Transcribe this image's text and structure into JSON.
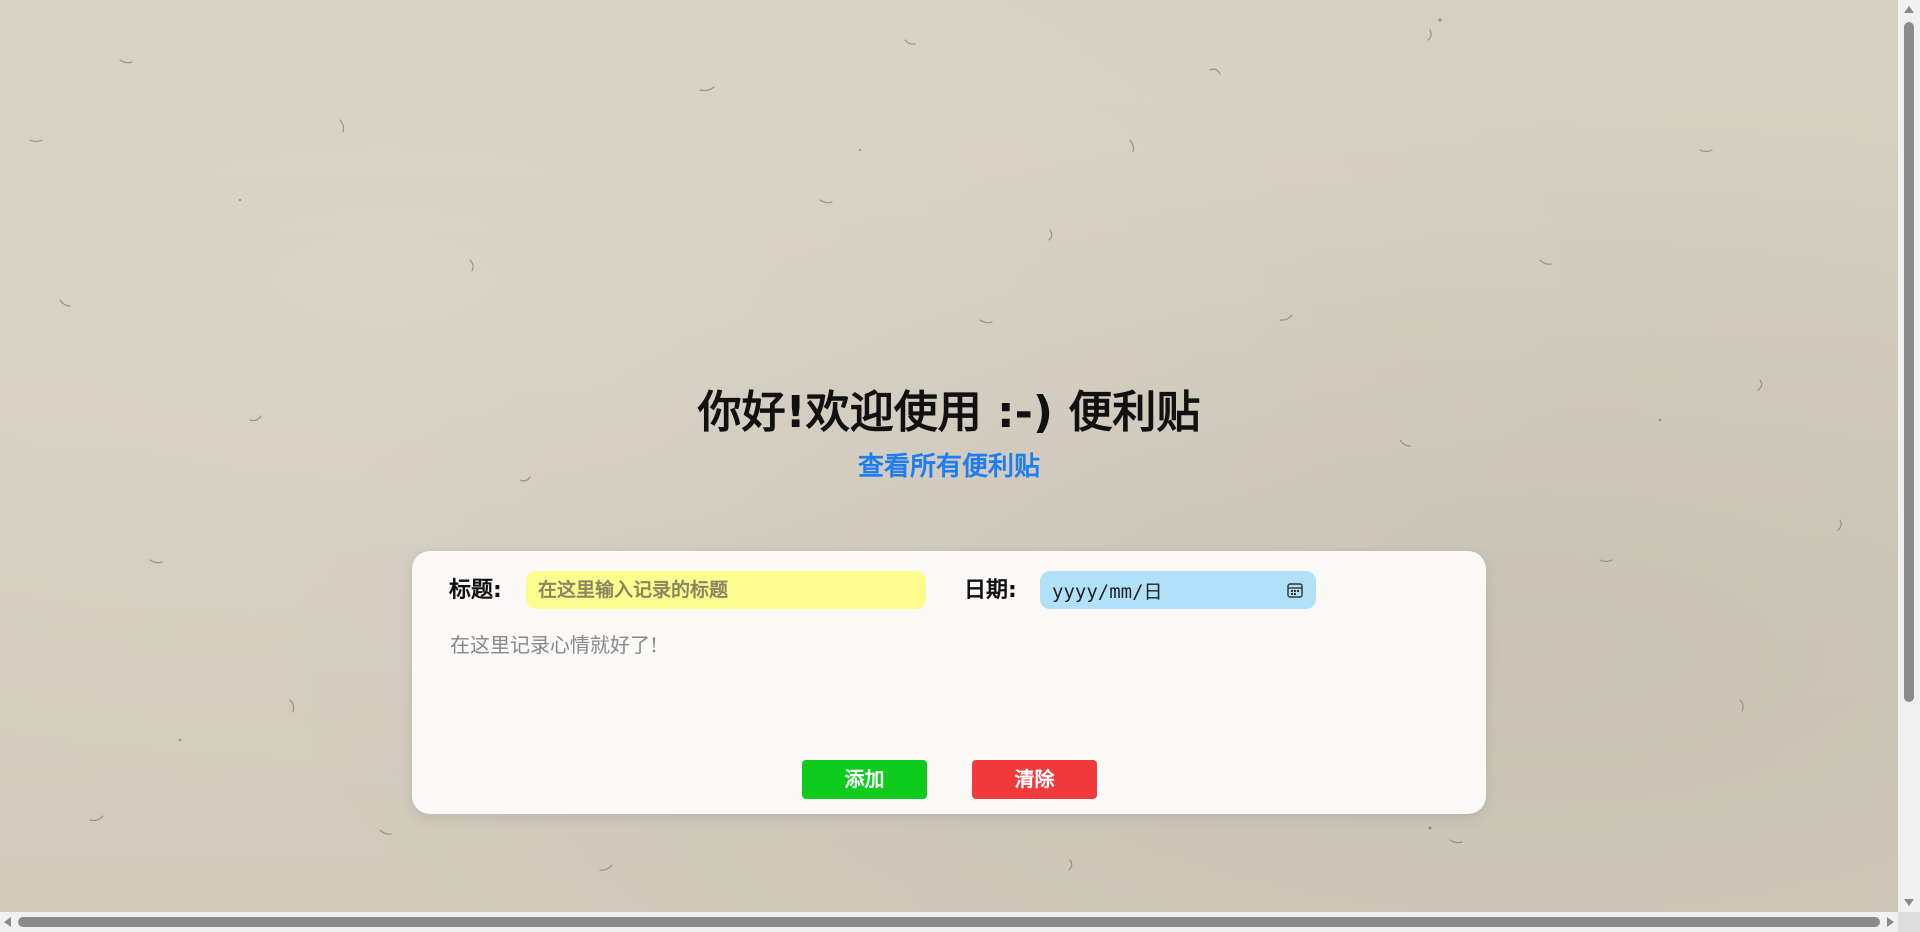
{
  "page": {
    "heading": "你好!欢迎使用 :-) 便利贴",
    "view_all_link": "查看所有便利贴"
  },
  "form": {
    "title_label": "标题:",
    "title_placeholder": "在这里输入记录的标题",
    "title_value": "",
    "date_label": "日期:",
    "date_placeholder": "yyyy/mm/日",
    "content_placeholder": "在这里记录心情就好了!",
    "content_value": "",
    "add_button": "添加",
    "clear_button": "清除"
  },
  "colors": {
    "background": "#d4cebf",
    "card": "#faf9f7",
    "title_input_bg": "#fdfd8f",
    "date_input_bg": "#b1e1f8",
    "link": "#1e7ef0",
    "add_button": "#0ecb1e",
    "clear_button": "#f23a3c"
  },
  "icons": {
    "date_picker": "calendar-icon"
  }
}
